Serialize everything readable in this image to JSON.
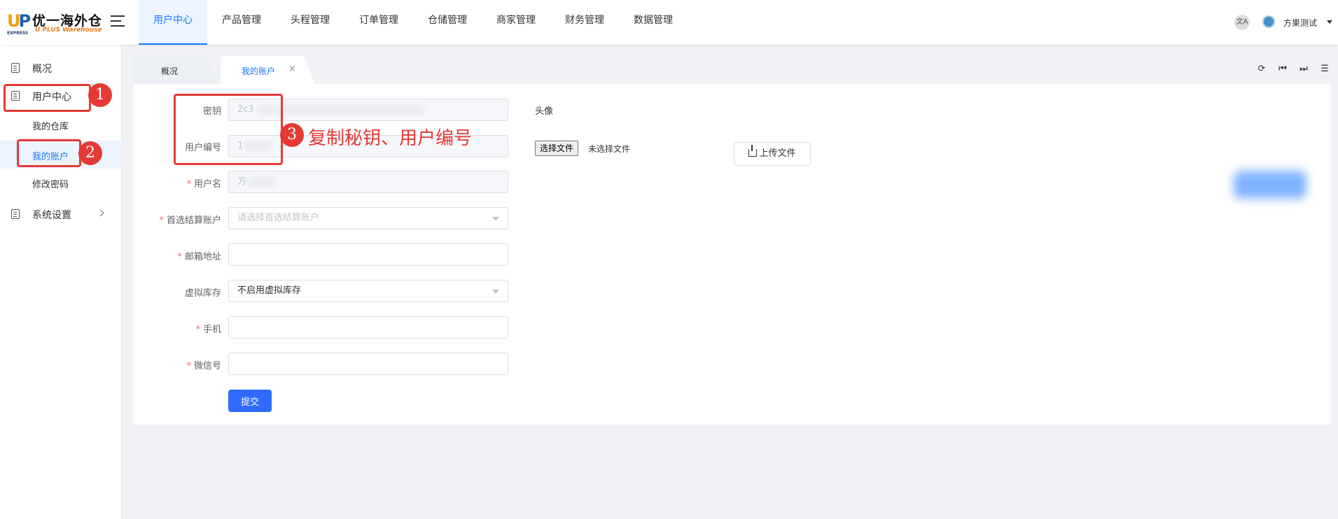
{
  "header": {
    "logo_mark_up": "U",
    "logo_mark_p": "P",
    "logo_express": "EXPRESS",
    "logo_cn": "优一海外仓",
    "logo_en": "U PLUS Warehouse",
    "nav": [
      "用户中心",
      "产品管理",
      "头程管理",
      "订单管理",
      "仓储管理",
      "商家管理",
      "财务管理",
      "数据管理"
    ],
    "active_nav": "用户中心",
    "lang_icon": "文A",
    "user_name": "方果测试"
  },
  "sidebar": {
    "items": [
      {
        "label": "概况"
      },
      {
        "label": "用户中心"
      },
      {
        "label": "我的仓库"
      },
      {
        "label": "我的账户"
      },
      {
        "label": "修改密码"
      },
      {
        "label": "系统设置"
      }
    ]
  },
  "tabs": {
    "overview": "概况",
    "account": "我的账户",
    "close": "×"
  },
  "form": {
    "secret_label": "密钥",
    "secret_value": "2c3",
    "user_no_label": "用户编号",
    "user_no_value": "1",
    "username_label": "用户名",
    "username_value": "方",
    "settle_label": "首选结算账户",
    "settle_placeholder": "请选择首选结算账户",
    "email_label": "邮箱地址",
    "email_value": "",
    "virtual_label": "虚拟库存",
    "virtual_value": "不启用虚拟库存",
    "phone_label": "手机",
    "phone_value": "",
    "wechat_label": "微信号",
    "wechat_value": "",
    "submit": "提交",
    "required_mark": "*"
  },
  "avatar": {
    "label": "头像",
    "choose_file": "选择文件",
    "no_file": "未选择文件",
    "upload": "上传文件"
  },
  "annotations": {
    "n1": "1",
    "n2": "2",
    "n3": "3",
    "text3": "复制秘钥、用户编号",
    "color": "#e53935"
  },
  "colors": {
    "accent": "#1677ff",
    "submit": "#2f6bff"
  }
}
